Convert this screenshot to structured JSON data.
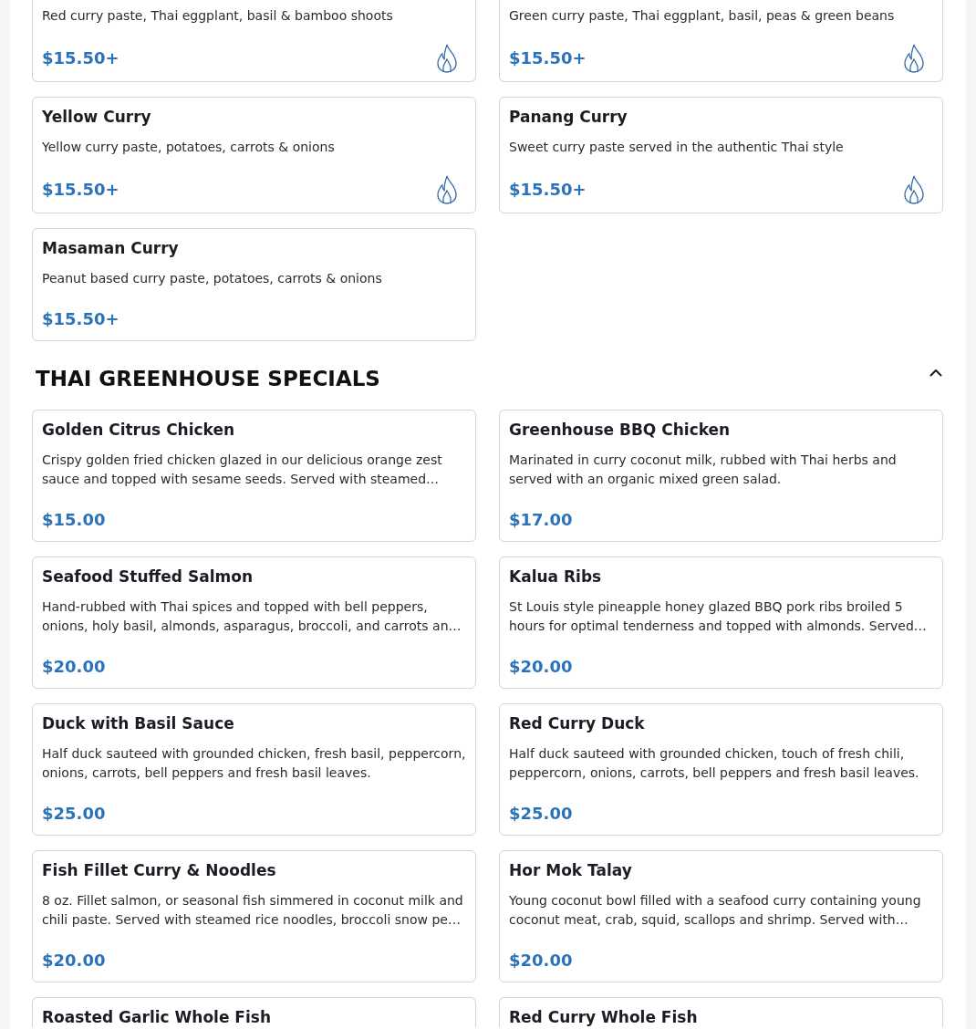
{
  "sections": [
    {
      "items": [
        {
          "description": "Red curry paste, Thai eggplant, basil & bamboo shoots",
          "price": "$15.50+",
          "spicy": true
        },
        {
          "description": "Green curry paste, Thai eggplant, basil, peas & green beans",
          "price": "$15.50+",
          "spicy": true
        },
        {
          "name": "Yellow Curry",
          "description": "Yellow curry paste, potatoes, carrots & onions",
          "price": "$15.50+",
          "spicy": true
        },
        {
          "name": "Panang Curry",
          "description": "Sweet curry paste served in the authentic Thai style",
          "price": "$15.50+",
          "spicy": true
        },
        {
          "name": "Masaman Curry",
          "description": "Peanut based curry paste, potatoes, carrots & onions",
          "price": "$15.50+",
          "spicy": false
        }
      ]
    },
    {
      "title": "THAI GREENHOUSE SPECIALS",
      "expanded": true,
      "items": [
        {
          "name": "Golden Citrus Chicken",
          "description": "Crispy golden fried chicken glazed in our delicious orange zest sauce and topped with sesame seeds. Served with steamed…",
          "price": "$15.00",
          "spicy": false
        },
        {
          "name": "Greenhouse BBQ Chicken",
          "description": "Marinated in curry coconut milk, rubbed with Thai herbs and served with an organic mixed green salad.",
          "price": "$17.00",
          "spicy": false
        },
        {
          "name": "Seafood Stuffed Salmon",
          "description": "Hand-rubbed with Thai spices and topped with bell peppers, onions, holy basil, almonds, asparagus, broccoli, and carrots an…",
          "price": "$20.00",
          "spicy": false
        },
        {
          "name": "Kalua Ribs",
          "description": "St Louis style pineapple honey glazed BBQ pork ribs broiled 5 hours for optimal tenderness and topped with almonds. Served…",
          "price": "$20.00",
          "spicy": false
        },
        {
          "name": "Duck with Basil Sauce",
          "description": "Half duck sauteed with grounded chicken, fresh basil, peppercorn, onions, carrots, bell peppers and fresh basil leaves.",
          "price": "$25.00",
          "spicy": false
        },
        {
          "name": "Red Curry Duck",
          "description": "Half duck sauteed with grounded chicken, touch of fresh chili, peppercorn, onions, carrots, bell peppers and fresh basil leaves.",
          "price": "$25.00",
          "spicy": false
        },
        {
          "name": "Fish Fillet Curry & Noodles",
          "description": "8 oz. Fillet salmon, or seasonal fish simmered in coconut milk and chili paste. Served with steamed rice noodles, broccoli snow pe…",
          "price": "$20.00",
          "spicy": false
        },
        {
          "name": "Hor Mok Talay",
          "description": "Young coconut bowl filled with a seafood curry containing young coconut meat, crab, squid, scallops and shrimp. Served with…",
          "price": "$20.00",
          "spicy": false
        },
        {
          "name": "Roasted Garlic Whole Fish"
        },
        {
          "name": "Red Curry Whole Fish"
        }
      ]
    }
  ]
}
